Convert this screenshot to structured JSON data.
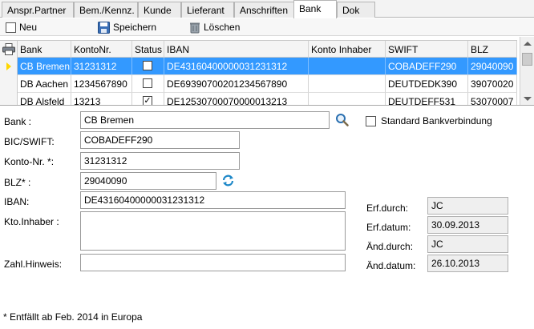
{
  "tabs": [
    {
      "label": "Anspr.Partner"
    },
    {
      "label": "Bem./Kennz."
    },
    {
      "label": "Kunde"
    },
    {
      "label": "Lieferant"
    },
    {
      "label": "Anschriften"
    },
    {
      "label": "Bank"
    },
    {
      "label": "Dok"
    }
  ],
  "toolbar": {
    "new_label": "Neu",
    "save_label": "Speichern",
    "delete_label": "Löschen"
  },
  "grid": {
    "columns": [
      "Bank",
      "KontoNr.",
      "Status",
      "IBAN",
      "Konto Inhaber",
      "SWIFT",
      "BLZ"
    ],
    "rows": [
      {
        "bank": "CB Bremen",
        "konto": "31231312",
        "status": false,
        "iban": "DE43160400000031231312",
        "inhaber": "",
        "swift": "COBADEFF290",
        "blz": "29040090",
        "selected": true
      },
      {
        "bank": "DB Aachen",
        "konto": "1234567890",
        "status": false,
        "iban": "DE69390700201234567890",
        "inhaber": "",
        "swift": "DEUTDEDK390",
        "blz": "39070020",
        "selected": false
      },
      {
        "bank": "DB Alsfeld",
        "konto": "13213",
        "status": true,
        "iban": "DE12530700070000013213",
        "inhaber": "",
        "swift": "DEUTDEFF531",
        "blz": "53070007",
        "selected": false
      }
    ]
  },
  "form": {
    "bank_label": "Bank :",
    "bank_value": "CB Bremen",
    "standard_label": "Standard Bankverbindung",
    "standard_checked": false,
    "bic_label": "BIC/SWIFT:",
    "bic_value": "COBADEFF290",
    "konto_label": "Konto-Nr. *:",
    "konto_value": "31231312",
    "blz_label": "BLZ* :",
    "blz_value": "29040090",
    "iban_label": "IBAN:",
    "iban_value": "DE43160400000031231312",
    "inhaber_label": "Kto.Inhaber :",
    "inhaber_value": "",
    "hinweis_label": "Zahl.Hinweis:",
    "hinweis_value": "",
    "erf_durch_label": "Erf.durch:",
    "erf_durch_value": "JC",
    "erf_datum_label": "Erf.datum:",
    "erf_datum_value": "30.09.2013",
    "aend_durch_label": "Änd.durch:",
    "aend_durch_value": "JC",
    "aend_datum_label": "Änd.datum:",
    "aend_datum_value": "26.10.2013"
  },
  "footnote": "* Entfällt ab Feb. 2014 in Europa",
  "colors": {
    "selection": "#3399ff",
    "selection_marker": "#ffd700",
    "search_icon": "#2a6fb0",
    "refresh_icon": "#1e88c8"
  },
  "icons": {
    "print": "printer-icon",
    "save": "floppy-disk-icon",
    "delete": "trash-can-icon",
    "search": "magnifier-icon",
    "refresh": "refresh-icon"
  }
}
